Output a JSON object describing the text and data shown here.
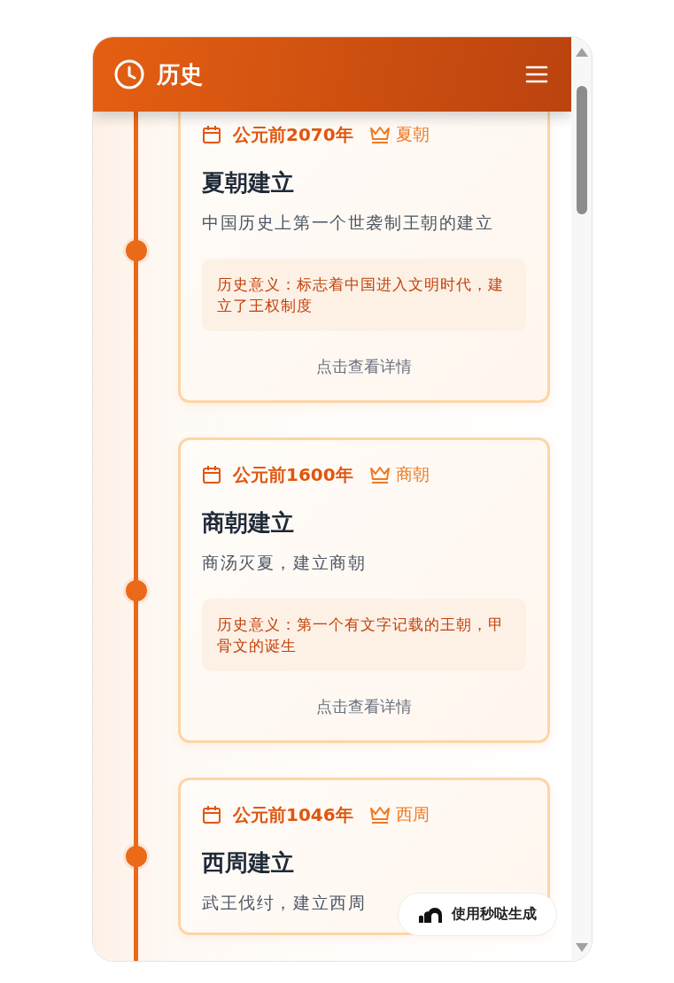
{
  "header": {
    "title": "历史"
  },
  "events": [
    {
      "date": "公元前2070年",
      "dynasty": "夏朝",
      "title": "夏朝建立",
      "description": "中国历史上第一个世袭制王朝的建立",
      "significance": "历史意义：标志着中国进入文明时代，建立了王权制度",
      "link": "点击查看详情"
    },
    {
      "date": "公元前1600年",
      "dynasty": "商朝",
      "title": "商朝建立",
      "description": "商汤灭夏，建立商朝",
      "significance": "历史意义：第一个有文字记载的王朝，甲骨文的诞生",
      "link": "点击查看详情"
    },
    {
      "date": "公元前1046年",
      "dynasty": "西周",
      "title": "西周建立",
      "description": "武王伐纣，建立西周"
    }
  ],
  "floating_button": {
    "label": "使用秒哒生成"
  }
}
